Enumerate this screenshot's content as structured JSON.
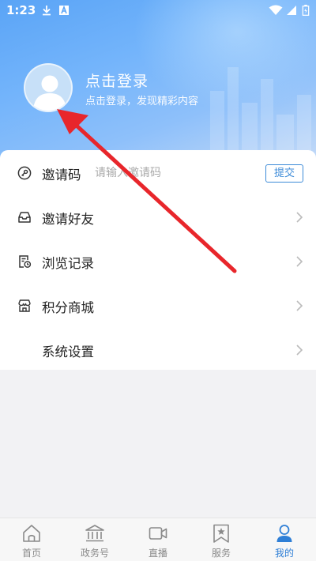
{
  "status_bar": {
    "time": "1:23"
  },
  "profile": {
    "title": "点击登录",
    "subtitle": "点击登录，发现精彩内容"
  },
  "invite": {
    "label": "邀请码",
    "placeholder": "请输入邀请码",
    "value": "",
    "submit_label": "提交"
  },
  "menu": [
    {
      "label": "邀请好友",
      "icon": "inbox-icon"
    },
    {
      "label": "浏览记录",
      "icon": "history-icon"
    },
    {
      "label": "积分商城",
      "icon": "store-icon"
    },
    {
      "label": "系统设置",
      "icon": ""
    }
  ],
  "tabs": [
    {
      "label": "首页",
      "icon": "home-icon",
      "active": false
    },
    {
      "label": "政务号",
      "icon": "government-icon",
      "active": false
    },
    {
      "label": "直播",
      "icon": "video-icon",
      "active": false
    },
    {
      "label": "服务",
      "icon": "bookmark-star-icon",
      "active": false
    },
    {
      "label": "我的",
      "icon": "person-icon",
      "active": true
    }
  ],
  "colors": {
    "accent": "#2f7fd6",
    "header_blue": "#5aa4f6",
    "arrow_red": "#e8262b"
  }
}
